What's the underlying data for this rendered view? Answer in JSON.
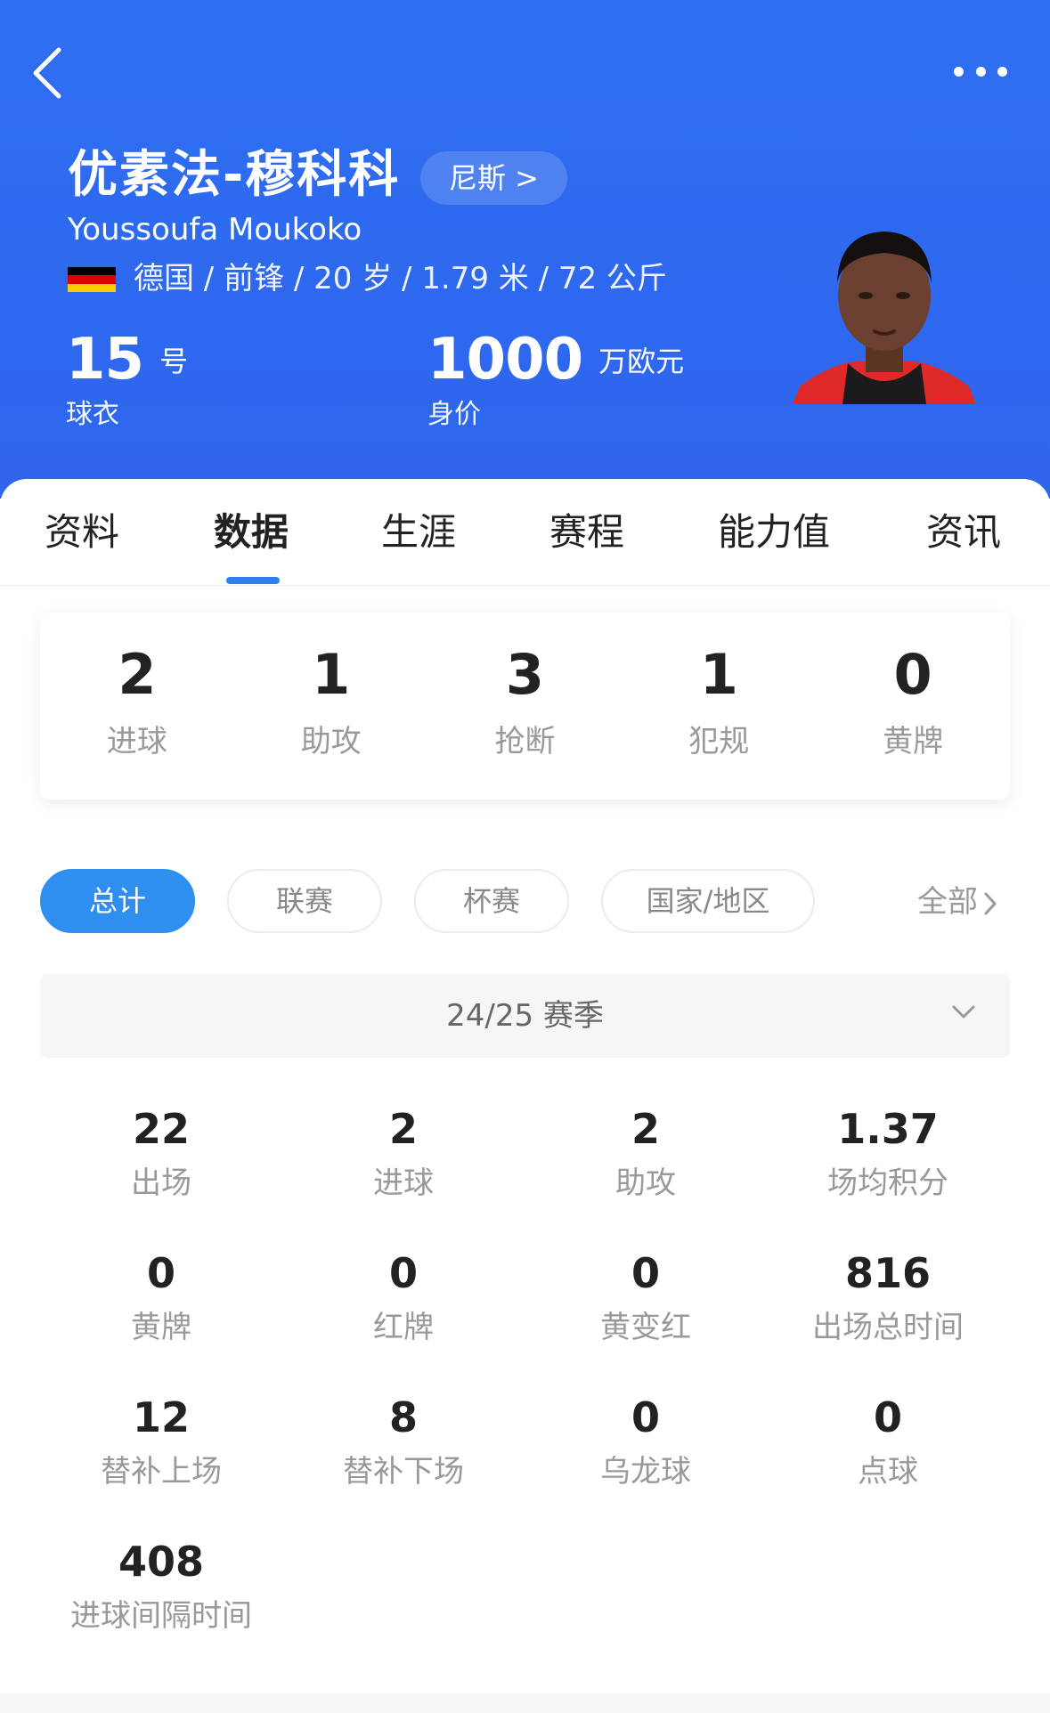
{
  "header": {
    "name_cn": "优素法-穆科科",
    "team": "尼斯 >",
    "name_en": "Youssoufa Moukoko",
    "bio": "德国 / 前锋 / 20 岁 / 1.79 米 / 72 公斤",
    "jersey_number": "15",
    "jersey_unit": "号",
    "jersey_label": "球衣",
    "market_value": "1000",
    "market_value_unit": "万欧元",
    "market_value_label": "身价",
    "flag_icon": "germany-flag-icon",
    "back_icon": "chevron-left-icon",
    "more_icon": "more-horizontal-icon"
  },
  "tabs": [
    "资料",
    "数据",
    "生涯",
    "赛程",
    "能力值",
    "资讯"
  ],
  "active_tab": "数据",
  "summary": [
    {
      "value": "2",
      "label": "进球"
    },
    {
      "value": "1",
      "label": "助攻"
    },
    {
      "value": "3",
      "label": "抢断"
    },
    {
      "value": "1",
      "label": "犯规"
    },
    {
      "value": "0",
      "label": "黄牌"
    }
  ],
  "filters": [
    "总计",
    "联赛",
    "杯赛",
    "国家/地区"
  ],
  "active_filter": "总计",
  "all_link": "全部",
  "season": "24/25 赛季",
  "stats": [
    {
      "value": "22",
      "label": "出场"
    },
    {
      "value": "2",
      "label": "进球"
    },
    {
      "value": "2",
      "label": "助攻"
    },
    {
      "value": "1.37",
      "label": "场均积分"
    },
    {
      "value": "0",
      "label": "黄牌"
    },
    {
      "value": "0",
      "label": "红牌"
    },
    {
      "value": "0",
      "label": "黄变红"
    },
    {
      "value": "816",
      "label": "出场总时间"
    },
    {
      "value": "12",
      "label": "替补上场"
    },
    {
      "value": "8",
      "label": "替补下场"
    },
    {
      "value": "0",
      "label": "乌龙球"
    },
    {
      "value": "0",
      "label": "点球"
    },
    {
      "value": "408",
      "label": "进球间隔时间"
    }
  ],
  "colors": {
    "header_blue": "#2f6ff1",
    "accent_blue": "#2f8ff0",
    "flag_black": "#000000",
    "flag_red": "#dd0000",
    "flag_gold": "#ffce00"
  }
}
